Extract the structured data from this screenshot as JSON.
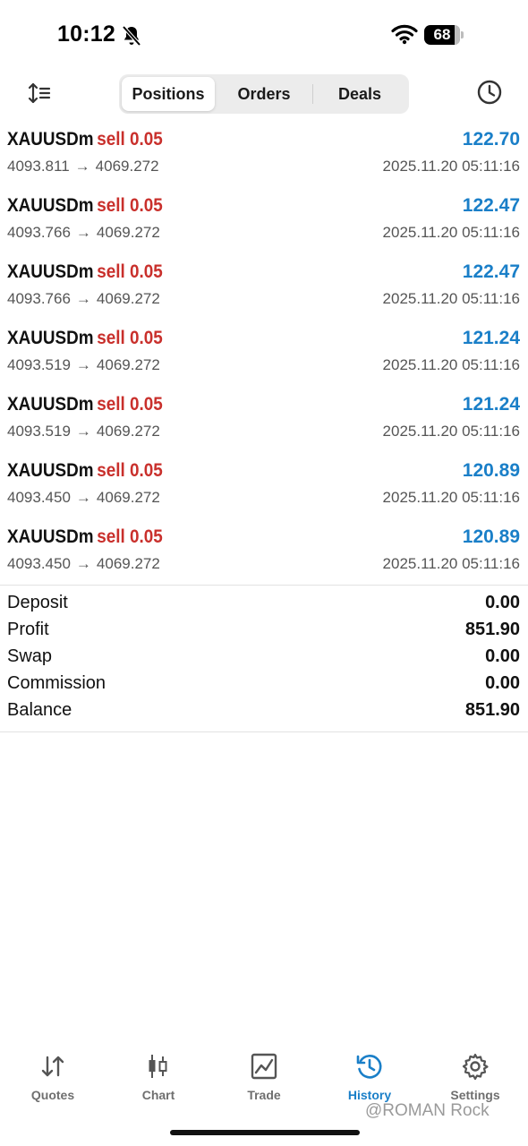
{
  "status_bar": {
    "time": "10:12",
    "battery": "68"
  },
  "header": {
    "tabs": [
      "Positions",
      "Orders",
      "Deals"
    ],
    "active_tab": "Positions"
  },
  "positions": [
    {
      "symbol": "XAUUSDm",
      "side": "sell",
      "volume": "0.05",
      "open_price": "4093.811",
      "close_price": "4069.272",
      "profit": "122.70",
      "time": "2025.11.20 05:11:16"
    },
    {
      "symbol": "XAUUSDm",
      "side": "sell",
      "volume": "0.05",
      "open_price": "4093.766",
      "close_price": "4069.272",
      "profit": "122.47",
      "time": "2025.11.20 05:11:16"
    },
    {
      "symbol": "XAUUSDm",
      "side": "sell",
      "volume": "0.05",
      "open_price": "4093.766",
      "close_price": "4069.272",
      "profit": "122.47",
      "time": "2025.11.20 05:11:16"
    },
    {
      "symbol": "XAUUSDm",
      "side": "sell",
      "volume": "0.05",
      "open_price": "4093.519",
      "close_price": "4069.272",
      "profit": "121.24",
      "time": "2025.11.20 05:11:16"
    },
    {
      "symbol": "XAUUSDm",
      "side": "sell",
      "volume": "0.05",
      "open_price": "4093.519",
      "close_price": "4069.272",
      "profit": "121.24",
      "time": "2025.11.20 05:11:16"
    },
    {
      "symbol": "XAUUSDm",
      "side": "sell",
      "volume": "0.05",
      "open_price": "4093.450",
      "close_price": "4069.272",
      "profit": "120.89",
      "time": "2025.11.20 05:11:16"
    },
    {
      "symbol": "XAUUSDm",
      "side": "sell",
      "volume": "0.05",
      "open_price": "4093.450",
      "close_price": "4069.272",
      "profit": "120.89",
      "time": "2025.11.20 05:11:16"
    }
  ],
  "arrow_glyph": "→",
  "summary": [
    {
      "label": "Deposit",
      "value": "0.00"
    },
    {
      "label": "Profit",
      "value": "851.90"
    },
    {
      "label": "Swap",
      "value": "0.00"
    },
    {
      "label": "Commission",
      "value": "0.00"
    },
    {
      "label": "Balance",
      "value": "851.90"
    }
  ],
  "tabbar": {
    "items": [
      {
        "label": "Quotes",
        "icon": "quotes-arrows-icon"
      },
      {
        "label": "Chart",
        "icon": "candlestick-chart-icon"
      },
      {
        "label": "Trade",
        "icon": "trade-chart-icon"
      },
      {
        "label": "History",
        "icon": "history-clock-icon"
      },
      {
        "label": "Settings",
        "icon": "gear-icon"
      }
    ],
    "active": "History"
  },
  "watermark": "@ROMAN Rock",
  "colors": {
    "sell": "#c9302c",
    "profit": "#1a7fc8",
    "active_tab": "#1a7fc8",
    "inactive_tab": "#6f6f6f"
  }
}
